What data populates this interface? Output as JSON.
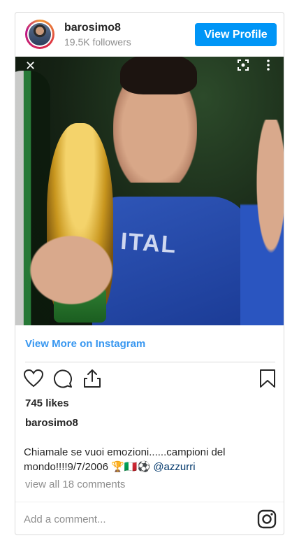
{
  "post": {
    "username": "barosimo8",
    "followers": "19.5K followers",
    "view_profile_label": "View Profile",
    "view_more_label": "View More on Instagram",
    "likes": "745 likes",
    "caption_username": "barosimo8",
    "caption_text": "Chiamale se vuoi emozioni......campioni del mondo!!!!9/7/2006",
    "caption_emoji": "🏆🇮🇹⚽",
    "caption_mention": "@azzurri",
    "comments_link": "view all 18 comments",
    "comment_placeholder": "Add a comment..."
  },
  "icons": {
    "close": "close-icon",
    "lens": "lens-icon",
    "more": "more-vertical-icon",
    "like": "heart-icon",
    "comment": "comment-icon",
    "share": "share-icon",
    "save": "bookmark-icon",
    "instagram": "instagram-icon"
  },
  "colors": {
    "accent": "#0095f6",
    "link": "#3897f0",
    "mention": "#00376b",
    "muted": "#8e8e8e"
  }
}
